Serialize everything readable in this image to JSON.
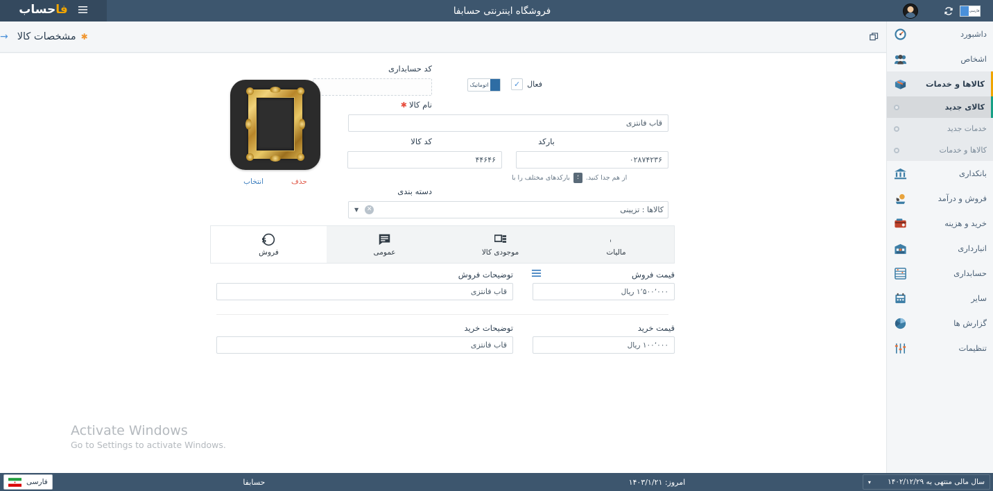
{
  "titlebar": {
    "logo_main": "حساب",
    "logo_accent": "فا",
    "hamburger_icon": "hamburger-icon",
    "app_title": "فروشگاه اینترنتی حسابفا",
    "help_icon": "question-mark-icon",
    "refresh_icon": "refresh-icon",
    "avatar_icon": "user-avatar",
    "lang_chip_label": "فارسی"
  },
  "sidebar": {
    "items": [
      {
        "label": "داشبورد",
        "icon": "dashboard-gauge-icon",
        "state": "normal"
      },
      {
        "label": "اشخاص",
        "icon": "people-icon",
        "state": "normal"
      },
      {
        "label": "کالاها و خدمات",
        "icon": "box-package-icon",
        "state": "open"
      },
      {
        "label": "بانکداری",
        "icon": "bank-icon",
        "state": "normal"
      },
      {
        "label": "فروش و درآمد",
        "icon": "sales-income-icon",
        "state": "normal"
      },
      {
        "label": "خرید و هزینه",
        "icon": "purchase-expense-icon",
        "state": "normal"
      },
      {
        "label": "انبارداری",
        "icon": "warehouse-icon",
        "state": "normal"
      },
      {
        "label": "حسابداری",
        "icon": "abacus-icon",
        "state": "normal"
      },
      {
        "label": "سایر",
        "icon": "other-icon",
        "state": "normal"
      },
      {
        "label": "گزارش ها",
        "icon": "reports-piechart-icon",
        "state": "normal"
      },
      {
        "label": "تنظیمات",
        "icon": "settings-sliders-icon",
        "state": "normal"
      }
    ],
    "subitems": [
      {
        "label": "کالای جدید",
        "active": true
      },
      {
        "label": "خدمات جدید",
        "active": false
      },
      {
        "label": "کالاها و خدمات",
        "active": false
      }
    ]
  },
  "pageheader": {
    "windows_icon": "restore-window-icon",
    "arrow_icon": "arrow-left-icon",
    "title": "مشخصات کالا",
    "modified_marker": "✱"
  },
  "toolbar": {
    "save_icon": "save-floppy-icon",
    "new_icon": "new-document-icon"
  },
  "form": {
    "accounting_code": {
      "label": "کد حسابداری",
      "value": "",
      "placeholder": "",
      "auto_label": "اتوماتیک",
      "active_label": "فعال",
      "active_checked": true,
      "check_icon": "checkmark-icon"
    },
    "product_name": {
      "label": "نام کالا",
      "required_marker": "✱",
      "value": "قاب فانتزی"
    },
    "product_code": {
      "label": "کد کالا",
      "value": "۴۴۶۴۶"
    },
    "barcode": {
      "label": "بارکد",
      "value": "۰۲۸۷۴۲۳۶",
      "hint_before": "بارکدهای مختلف را با",
      "hint_key": "؛",
      "hint_after": "از هم جدا کنید."
    },
    "category": {
      "label": "دسته بندی",
      "value": "کالاها : تزیینی",
      "clear_icon": "clear-circle-icon",
      "caret_icon": "chevron-down-icon"
    },
    "image": {
      "alt": "قاب عکس طلایی",
      "select_label": "انتخاب",
      "delete_label": "حذف"
    }
  },
  "tabs": [
    {
      "label": "فروش",
      "icon": "dollar-coin-icon",
      "active": true
    },
    {
      "label": "عمومی",
      "icon": "document-lines-icon",
      "active": false
    },
    {
      "label": "موجودی کالا",
      "icon": "stock-boxes-icon",
      "active": false
    },
    {
      "label": "مالیات",
      "icon": "percent-icon",
      "active": false
    }
  ],
  "sales_pane": {
    "sale_price": {
      "label": "قیمت فروش",
      "value": "۱٬۵۰۰٬۰۰۰ ریال",
      "menu_icon": "hamburger-menu-icon"
    },
    "sale_desc": {
      "label": "توضیحات فروش",
      "value": "قاب فانتزی"
    },
    "purchase_price": {
      "label": "قیمت خرید",
      "value": "۱۰۰٬۰۰۰ ریال"
    },
    "purchase_desc": {
      "label": "توضیحات خرید",
      "value": "قاب فانتزی"
    }
  },
  "watermark": {
    "title": "Activate Windows",
    "subtitle": "Go to Settings to activate Windows."
  },
  "statusbar": {
    "fiscal_year": "سال مالی منتهی به ۱۴۰۲/۱۲/۲۹",
    "fiscal_caret": "▾",
    "today": "امروز: ۱۴۰۳/۱/۲۱",
    "company": "حسابفا",
    "language": "فارسی",
    "flag_icon": "iran-flag-icon"
  },
  "colors": {
    "titlebar_bg": "#3d566e",
    "brand_bg": "#34495e",
    "accent_gold": "#f0a500",
    "active_teal": "#16a085",
    "link_blue": "#3e7fbf",
    "danger_red": "#e05a4a"
  }
}
